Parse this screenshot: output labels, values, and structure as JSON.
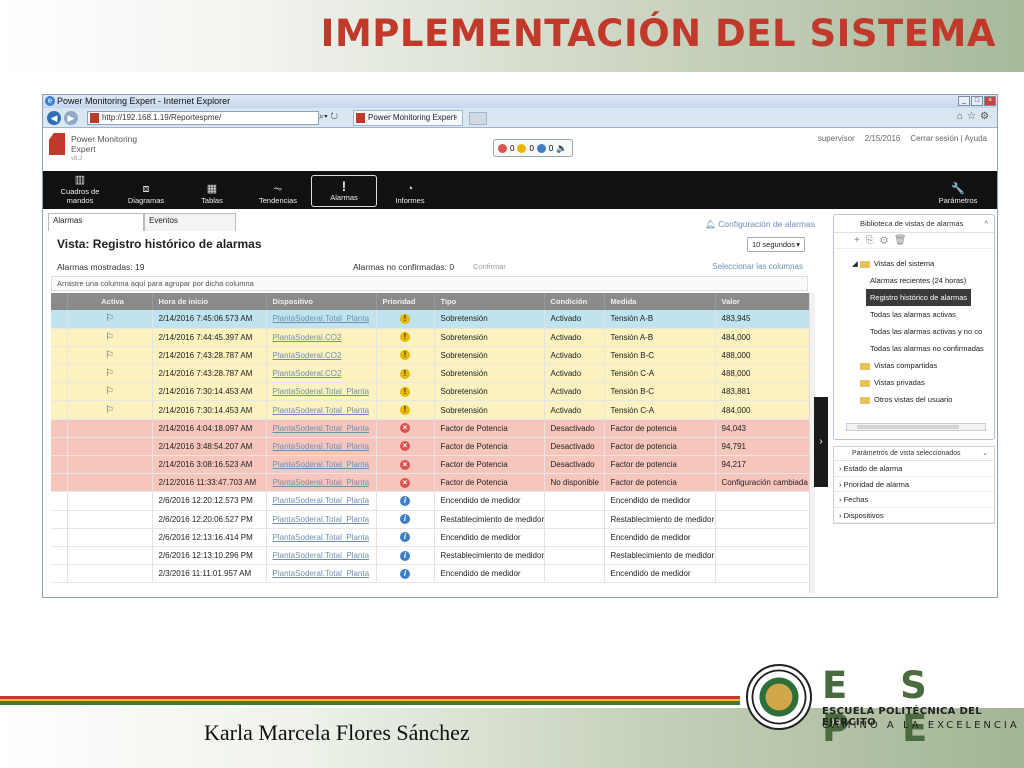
{
  "slide": {
    "title": "IMPLEMENTACIÓN DEL SISTEMA",
    "author": "Karla Marcela Flores Sánchez",
    "institution": {
      "acronym": "E S P E",
      "name": "ESCUELA POLITÉCNICA DEL EJÉRCITO",
      "motto": "CAMINO A LA EXCELENCIA"
    }
  },
  "browser": {
    "window_title": "Power Monitoring Expert - Internet Explorer",
    "address": "http://192.168.1.19/Reportespme/",
    "tab_label": "Power Monitoring Expert"
  },
  "app": {
    "logo_text": "Power Monitoring Expert",
    "logo_version": "v8.2",
    "counters": [
      "0",
      "0",
      "0"
    ],
    "user": "supervisor",
    "date": "2/15/2016",
    "logout": "Cerrar sesión",
    "help": "Ayuda",
    "menu": [
      {
        "label": "Cuadros de mandos",
        "icon": "dashboard-icon",
        "glyph": "▥"
      },
      {
        "label": "Diagramas",
        "icon": "diagram-icon",
        "glyph": "⧈"
      },
      {
        "label": "Tablas",
        "icon": "table-icon",
        "glyph": "▦"
      },
      {
        "label": "Tendencias",
        "icon": "trend-icon",
        "glyph": "⏦"
      },
      {
        "label": "Alarmas",
        "icon": "alarm-icon",
        "glyph": "!"
      },
      {
        "label": "Informes",
        "icon": "report-icon",
        "glyph": "◔"
      }
    ],
    "params_label": "Parámetros"
  },
  "alarms_view": {
    "tabs": [
      "Alarmas",
      "Eventos"
    ],
    "config_link": "Configuración de alarmas",
    "view_title": "Vista: Registro histórico de alarmas",
    "refresh_interval": "10 segundos",
    "shown_label": "Alarmas mostradas:",
    "shown_count": "19",
    "unconfirmed_label": "Alarmas no confirmadas:",
    "unconfirmed_count": "0",
    "confirm_button": "Confirmar",
    "select_columns": "Seleccionar las columnas",
    "group_hint": "Arrastre una columna aquí para agrupar por dicha columna",
    "columns": [
      "",
      "Activa",
      "Hora de inicio",
      "Dispositivo",
      "Prioridad",
      "Tipo",
      "Condición",
      "Medida",
      "Valor"
    ],
    "rows": [
      {
        "style": "selected",
        "active": "⚐",
        "start": "2/14/2016 7:45:06.573 AM",
        "device": "PlantaSoderal.Total_Planta",
        "priority": "warn",
        "type": "Sobretensión",
        "condition": "Activado",
        "measure": "Tensión A-B",
        "value": "483,945"
      },
      {
        "style": "yellow",
        "active": "⚐",
        "start": "2/14/2016 7:44:45.397 AM",
        "device": "PlantaSoderal.CO2",
        "priority": "warn",
        "type": "Sobretensión",
        "condition": "Activado",
        "measure": "Tensión A-B",
        "value": "484,000"
      },
      {
        "style": "yellow",
        "active": "⚐",
        "start": "2/14/2016 7:43:28.787 AM",
        "device": "PlantaSoderal.CO2",
        "priority": "warn",
        "type": "Sobretensión",
        "condition": "Activado",
        "measure": "Tensión B-C",
        "value": "488,000"
      },
      {
        "style": "yellow",
        "active": "⚐",
        "start": "2/14/2016 7:43:28.787 AM",
        "device": "PlantaSoderal.CO2",
        "priority": "warn",
        "type": "Sobretensión",
        "condition": "Activado",
        "measure": "Tensión C-A",
        "value": "488,000"
      },
      {
        "style": "yellow",
        "active": "⚐",
        "start": "2/14/2016 7:30:14.453 AM",
        "device": "PlantaSoderal.Total_Planta",
        "priority": "warn",
        "type": "Sobretensión",
        "condition": "Activado",
        "measure": "Tensión B-C",
        "value": "483,881"
      },
      {
        "style": "yellow",
        "active": "⚐",
        "start": "2/14/2016 7:30:14.453 AM",
        "device": "PlantaSoderal.Total_Planta",
        "priority": "warn",
        "type": "Sobretensión",
        "condition": "Activado",
        "measure": "Tensión C-A",
        "value": "484,000"
      },
      {
        "style": "red",
        "active": "",
        "start": "2/14/2016 4:04:18.097 AM",
        "device": "PlantaSoderal.Total_Planta",
        "priority": "crit",
        "type": "Factor de Potencia",
        "condition": "Desactivado",
        "measure": "Factor de potencia",
        "value": "94,043"
      },
      {
        "style": "red",
        "active": "",
        "start": "2/14/2016 3:48:54.207 AM",
        "device": "PlantaSoderal.Total_Planta",
        "priority": "crit",
        "type": "Factor de Potencia",
        "condition": "Desactivado",
        "measure": "Factor de potencia",
        "value": "94,791"
      },
      {
        "style": "red",
        "active": "",
        "start": "2/14/2016 3:08:16.523 AM",
        "device": "PlantaSoderal.Total_Planta",
        "priority": "crit",
        "type": "Factor de Potencia",
        "condition": "Desactivado",
        "measure": "Factor de potencia",
        "value": "94,217"
      },
      {
        "style": "red",
        "active": "",
        "start": "2/12/2016 11:33:47.703 AM",
        "device": "PlantaSoderal.Total_Planta",
        "priority": "crit",
        "type": "Factor de Potencia",
        "condition": "No disponible",
        "measure": "Factor de potencia",
        "value": "Configuración cambiada"
      },
      {
        "style": "white",
        "active": "",
        "start": "2/6/2016 12:20:12.573 PM",
        "device": "PlantaSoderal.Total_Planta",
        "priority": "info",
        "type": "Encendido de medidor",
        "condition": "",
        "measure": "Encendido de medidor",
        "value": ""
      },
      {
        "style": "white",
        "active": "",
        "start": "2/6/2016 12:20:06.527 PM",
        "device": "PlantaSoderal.Total_Planta",
        "priority": "info",
        "type": "Restablecimiento de medidor",
        "condition": "",
        "measure": "Restablecimiento de medidor",
        "value": ""
      },
      {
        "style": "white",
        "active": "",
        "start": "2/6/2016 12:13:16.414 PM",
        "device": "PlantaSoderal.Total_Planta",
        "priority": "info",
        "type": "Encendido de medidor",
        "condition": "",
        "measure": "Encendido de medidor",
        "value": ""
      },
      {
        "style": "white",
        "active": "",
        "start": "2/6/2016 12:13:10.296 PM",
        "device": "PlantaSoderal.Total_Planta",
        "priority": "info",
        "type": "Restablecimiento de medidor",
        "condition": "",
        "measure": "Restablecimiento de medidor",
        "value": ""
      },
      {
        "style": "white",
        "active": "",
        "start": "2/3/2016 11:11:01.957 AM",
        "device": "PlantaSoderal.Total_Planta",
        "priority": "info",
        "type": "Encendido de medidor",
        "condition": "",
        "measure": "Encendido de medidor",
        "value": ""
      }
    ]
  },
  "library_panel": {
    "title": "Biblioteca de vistas de alarmas",
    "root": "Vistas del sistema",
    "system_views": [
      "Alarmas recientes (24 horas)",
      "Registro histórico de alarmas",
      "Todas las alarmas activas",
      "Todas las alarmas activas y no co",
      "Todas las alarmas no confirmadas"
    ],
    "folders": [
      "Vistas compartidas",
      "Vistas privadas",
      "Otros vistas del usuario"
    ]
  },
  "params_panel": {
    "title": "Parámetros de vista seleccionados",
    "items": [
      "Estado de alarma",
      "Prioridad de alarma",
      "Fechas",
      "Dispositivos"
    ]
  },
  "colors": {
    "title_red": "#c0392b",
    "selected_row": "#bfe4ef",
    "warning_row": "#fbf2c0",
    "critical_row": "#f6c6bd",
    "espe_green": "#4a6b3f"
  }
}
